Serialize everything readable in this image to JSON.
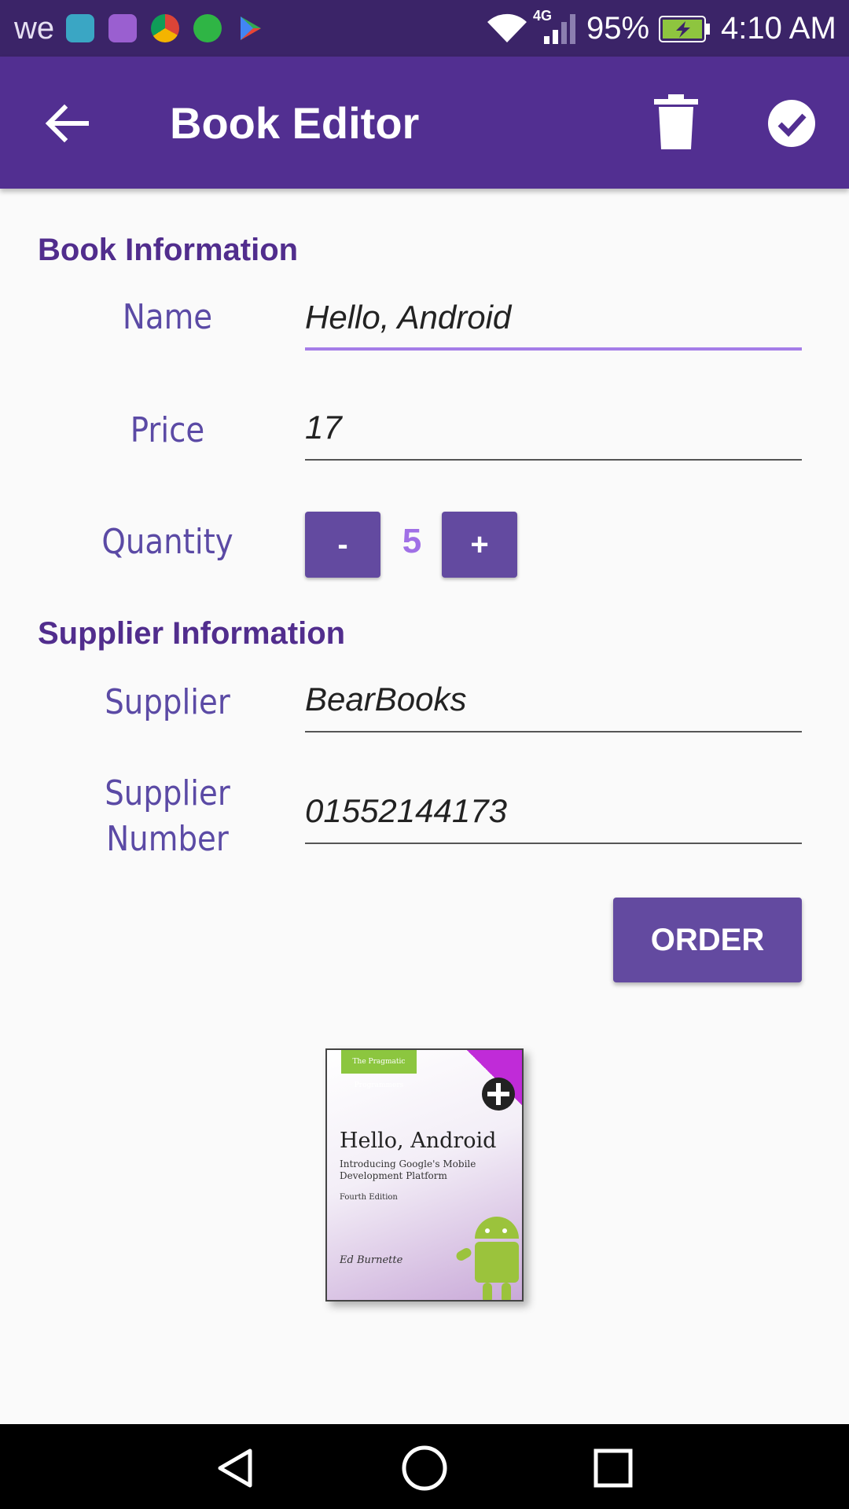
{
  "status_bar": {
    "carrier": "we",
    "network": "4G",
    "battery": "95%",
    "time": "4:10 AM",
    "app_icons": [
      "android-icon",
      "gallery-icon",
      "chrome-icon",
      "whatsapp-icon",
      "play-store-icon"
    ]
  },
  "app_bar": {
    "title": "Book Editor",
    "back_icon": "back-arrow-icon",
    "delete_icon": "trash-icon",
    "save_icon": "check-circle-icon"
  },
  "book_section": {
    "title": "Book Information",
    "name_label": "Name",
    "name_value": "Hello, Android",
    "price_label": "Price",
    "price_value": "17",
    "quantity_label": "Quantity",
    "decrement_label": "-",
    "quantity_value": "5",
    "increment_label": "+"
  },
  "supplier_section": {
    "title": "Supplier Information",
    "supplier_label": "Supplier",
    "supplier_value": "BearBooks",
    "number_label_1": "Supplier",
    "number_label_2": "Number",
    "number_value": "01552144173",
    "order_label": "ORDER"
  },
  "cover": {
    "publisher": "The Pragmatic Programmers",
    "title": "Hello, Android",
    "subtitle": "Introducing Google's Mobile Development Platform",
    "edition": "Fourth Edition",
    "author": "Ed Burnette"
  },
  "colors": {
    "status_bar": "#3b2468",
    "app_bar": "#522f91",
    "accent": "#634aa0",
    "label": "#5b4aa5",
    "active_underline": "#a57de8"
  }
}
